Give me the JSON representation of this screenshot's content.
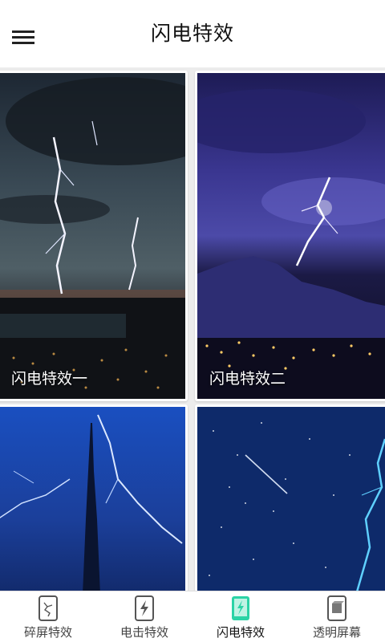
{
  "header": {
    "title": "闪电特效",
    "menu_icon": "hamburger-menu-icon"
  },
  "cards": [
    {
      "label": "闪电特效一",
      "image": "lightning-over-city-rain"
    },
    {
      "label": "闪电特效二",
      "image": "purple-lightning-over-mountain-city"
    },
    {
      "label": "",
      "image": "lightning-around-skyscraper"
    },
    {
      "label": "",
      "image": "starry-sky-meteor-lightning"
    }
  ],
  "bottom_nav": {
    "active_index": 2,
    "active_color": "#2bd3a6",
    "items": [
      {
        "label": "碎屏特效",
        "icon": "cracked-phone-icon"
      },
      {
        "label": "电击特效",
        "icon": "electric-phone-icon"
      },
      {
        "label": "闪电特效",
        "icon": "lightning-phone-icon"
      },
      {
        "label": "透明屏幕",
        "icon": "transparent-phone-icon"
      }
    ]
  }
}
